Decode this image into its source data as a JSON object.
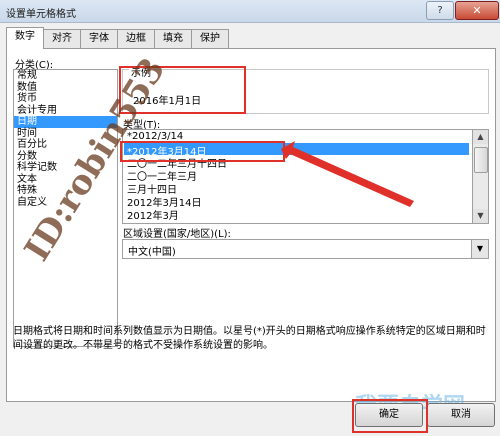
{
  "window": {
    "title": "设置单元格格式",
    "help": "?",
    "close": "✕"
  },
  "tabs": [
    "数字",
    "对齐",
    "字体",
    "边框",
    "填充",
    "保护"
  ],
  "category": {
    "label": "分类(C):",
    "items": [
      "常规",
      "数值",
      "货币",
      "会计专用",
      "日期",
      "时间",
      "百分比",
      "分数",
      "科学记数",
      "文本",
      "特殊",
      "自定义"
    ],
    "selected": "日期"
  },
  "sample": {
    "legend": "示例",
    "value": "2016年1月1日"
  },
  "type": {
    "label": "类型(T):",
    "items": [
      "*2012/3/14",
      "*2012年3月14日",
      "二〇一二年三月十四日",
      "二〇一二年三月",
      "三月十四日",
      "2012年3月14日",
      "2012年3月"
    ],
    "selected": "*2012年3月14日"
  },
  "region": {
    "label": "区域设置(国家/地区)(L):",
    "value": "中文(中国)"
  },
  "description": "日期格式将日期和时间系列数值显示为日期值。以星号(*)开头的日期格式响应操作系统特定的区域日期和时间设置的更改。不带星号的格式不受操作系统设置的影响。",
  "watermark": {
    "text": "ID:robin553",
    "bottom": "我要自学网"
  },
  "buttons": {
    "ok": "确定",
    "cancel": "取消"
  },
  "colors": {
    "highlight": "#e0302a",
    "selection": "#3399ff"
  }
}
